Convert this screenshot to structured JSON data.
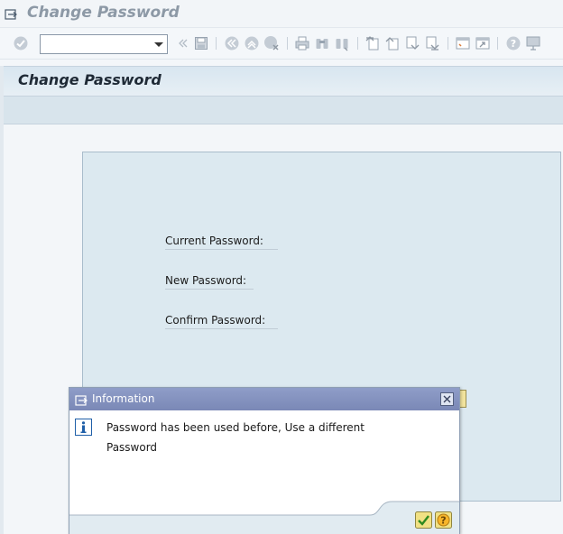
{
  "window": {
    "title": "Change Password"
  },
  "toolbar": {
    "command_field": {
      "value": "",
      "placeholder": ""
    },
    "icons": [
      "enter-icon",
      "back-nav-icon",
      "save-icon",
      "back-icon",
      "exit-icon",
      "cancel-icon",
      "print-icon",
      "find-icon",
      "find-next-icon",
      "first-page-icon",
      "previous-page-icon",
      "next-page-icon",
      "last-page-icon",
      "create-session-icon",
      "shortcut-icon",
      "help-icon",
      "customize-layout-icon"
    ]
  },
  "screen": {
    "title": "Change Password",
    "fields": [
      {
        "label": "Current Password:"
      },
      {
        "label": "New Password:"
      },
      {
        "label": "Confirm Password:"
      }
    ]
  },
  "dialog": {
    "title": "Information",
    "message_line1": "Password has been used before, Use a different",
    "message_line2": "Password",
    "buttons": [
      "confirm-icon",
      "help-icon"
    ]
  },
  "colors": {
    "panel_bg": "#dce9f0",
    "dialog_title_bg": "#7f8dbb",
    "header_bg": "#d8e6f0"
  }
}
